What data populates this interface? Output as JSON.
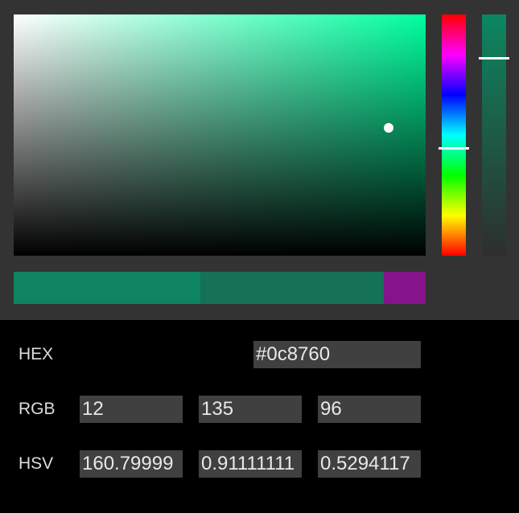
{
  "color": {
    "hex": "#0c8760",
    "hue_color": "#00ff9f",
    "hue_degrees": 160.79999,
    "saturation": 0.91111111,
    "value": 0.5294117,
    "alpha": 0.82
  },
  "swatches": {
    "current": "#0e8462",
    "previous": "#157257",
    "extra": "#85138a"
  },
  "fields": {
    "hex": {
      "label": "HEX",
      "value": "#0c8760"
    },
    "rgb": {
      "label": "RGB",
      "r": "12",
      "g": "135",
      "b": "96"
    },
    "hsv": {
      "label": "HSV",
      "h": "160.79999",
      "s": "0.91111111",
      "v": "0.5294117"
    }
  }
}
